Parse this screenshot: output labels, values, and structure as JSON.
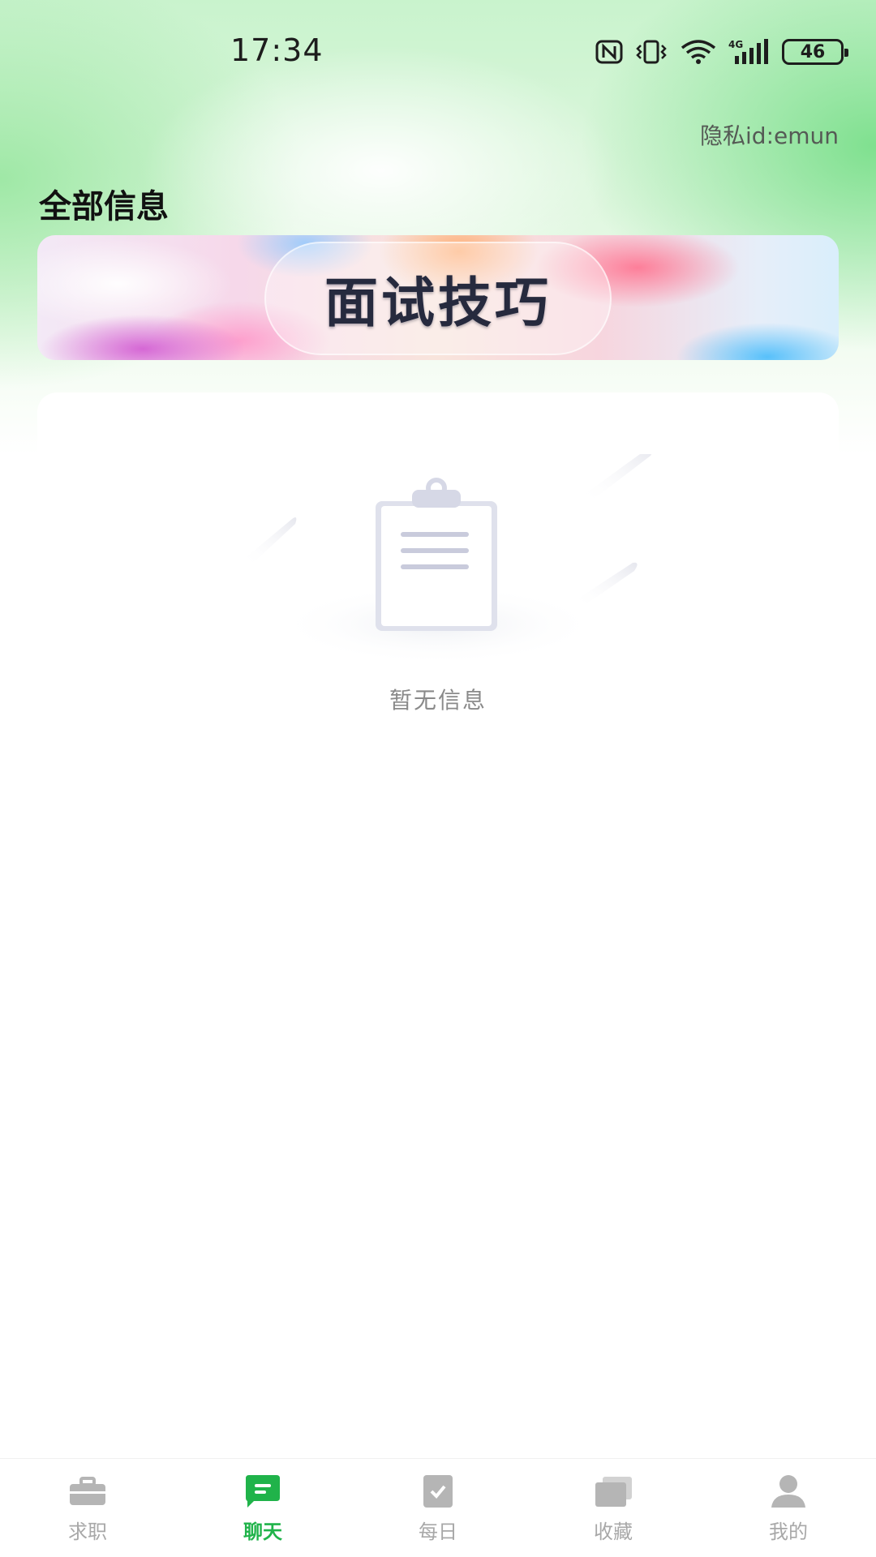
{
  "status_bar": {
    "time": "17:34",
    "battery": "46",
    "icons": [
      "nfc-icon",
      "vibrate-icon",
      "wifi-icon",
      "signal-4g-icon",
      "battery-icon"
    ]
  },
  "header": {
    "privacy_id": "隐私id:emun",
    "title": "全部信息"
  },
  "banner": {
    "text": "面试技巧"
  },
  "empty_state": {
    "icon": "clipboard-icon",
    "text": "暂无信息"
  },
  "tab_bar": {
    "active_index": 1,
    "active_color": "#20b34a",
    "inactive_color": "#a8a8a8",
    "items": [
      {
        "label": "求职",
        "icon": "briefcase-icon"
      },
      {
        "label": "聊天",
        "icon": "chat-icon"
      },
      {
        "label": "每日",
        "icon": "daily-check-icon"
      },
      {
        "label": "收藏",
        "icon": "collection-icon"
      },
      {
        "label": "我的",
        "icon": "user-icon"
      }
    ]
  }
}
